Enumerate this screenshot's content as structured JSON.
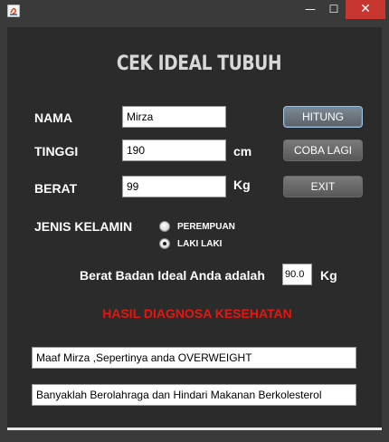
{
  "window": {
    "minimize_glyph": "—",
    "maximize_glyph": "☐",
    "close_glyph": "✕"
  },
  "form": {
    "heading": "CEK IDEAL TUBUH",
    "nama_label": "NAMA",
    "nama_value": "Mirza",
    "tinggi_label": "TINGGI",
    "tinggi_value": "190",
    "tinggi_unit": "cm",
    "berat_label": "BERAT",
    "berat_value": "99",
    "berat_unit": "Kg",
    "gender_label": "JENIS KELAMIN",
    "gender_options": [
      {
        "label": "PEREMPUAN",
        "checked": false
      },
      {
        "label": "LAKI LAKI",
        "checked": true
      }
    ],
    "ideal_label": "Berat Badan Ideal Anda adalah",
    "ideal_value": "90.0",
    "ideal_unit": "Kg"
  },
  "buttons": {
    "hitung": "HITUNG",
    "coba_lagi": "COBA LAGI",
    "exit": "EXIT"
  },
  "result": {
    "heading": "HASIL DIAGNOSA KESEHATAN",
    "message": "Maaf Mirza ,Sepertinya anda OVERWEIGHT",
    "advice": "Banyaklah Berolahraga dan Hindari Makanan Berkolesterol"
  },
  "colors": {
    "window_frame": "#3a3a3a",
    "panel_background": "#2b2b2b",
    "heading_text": "#d8d8d8",
    "diagnosis_text": "#e8150f",
    "close_button": "#c7372f"
  }
}
